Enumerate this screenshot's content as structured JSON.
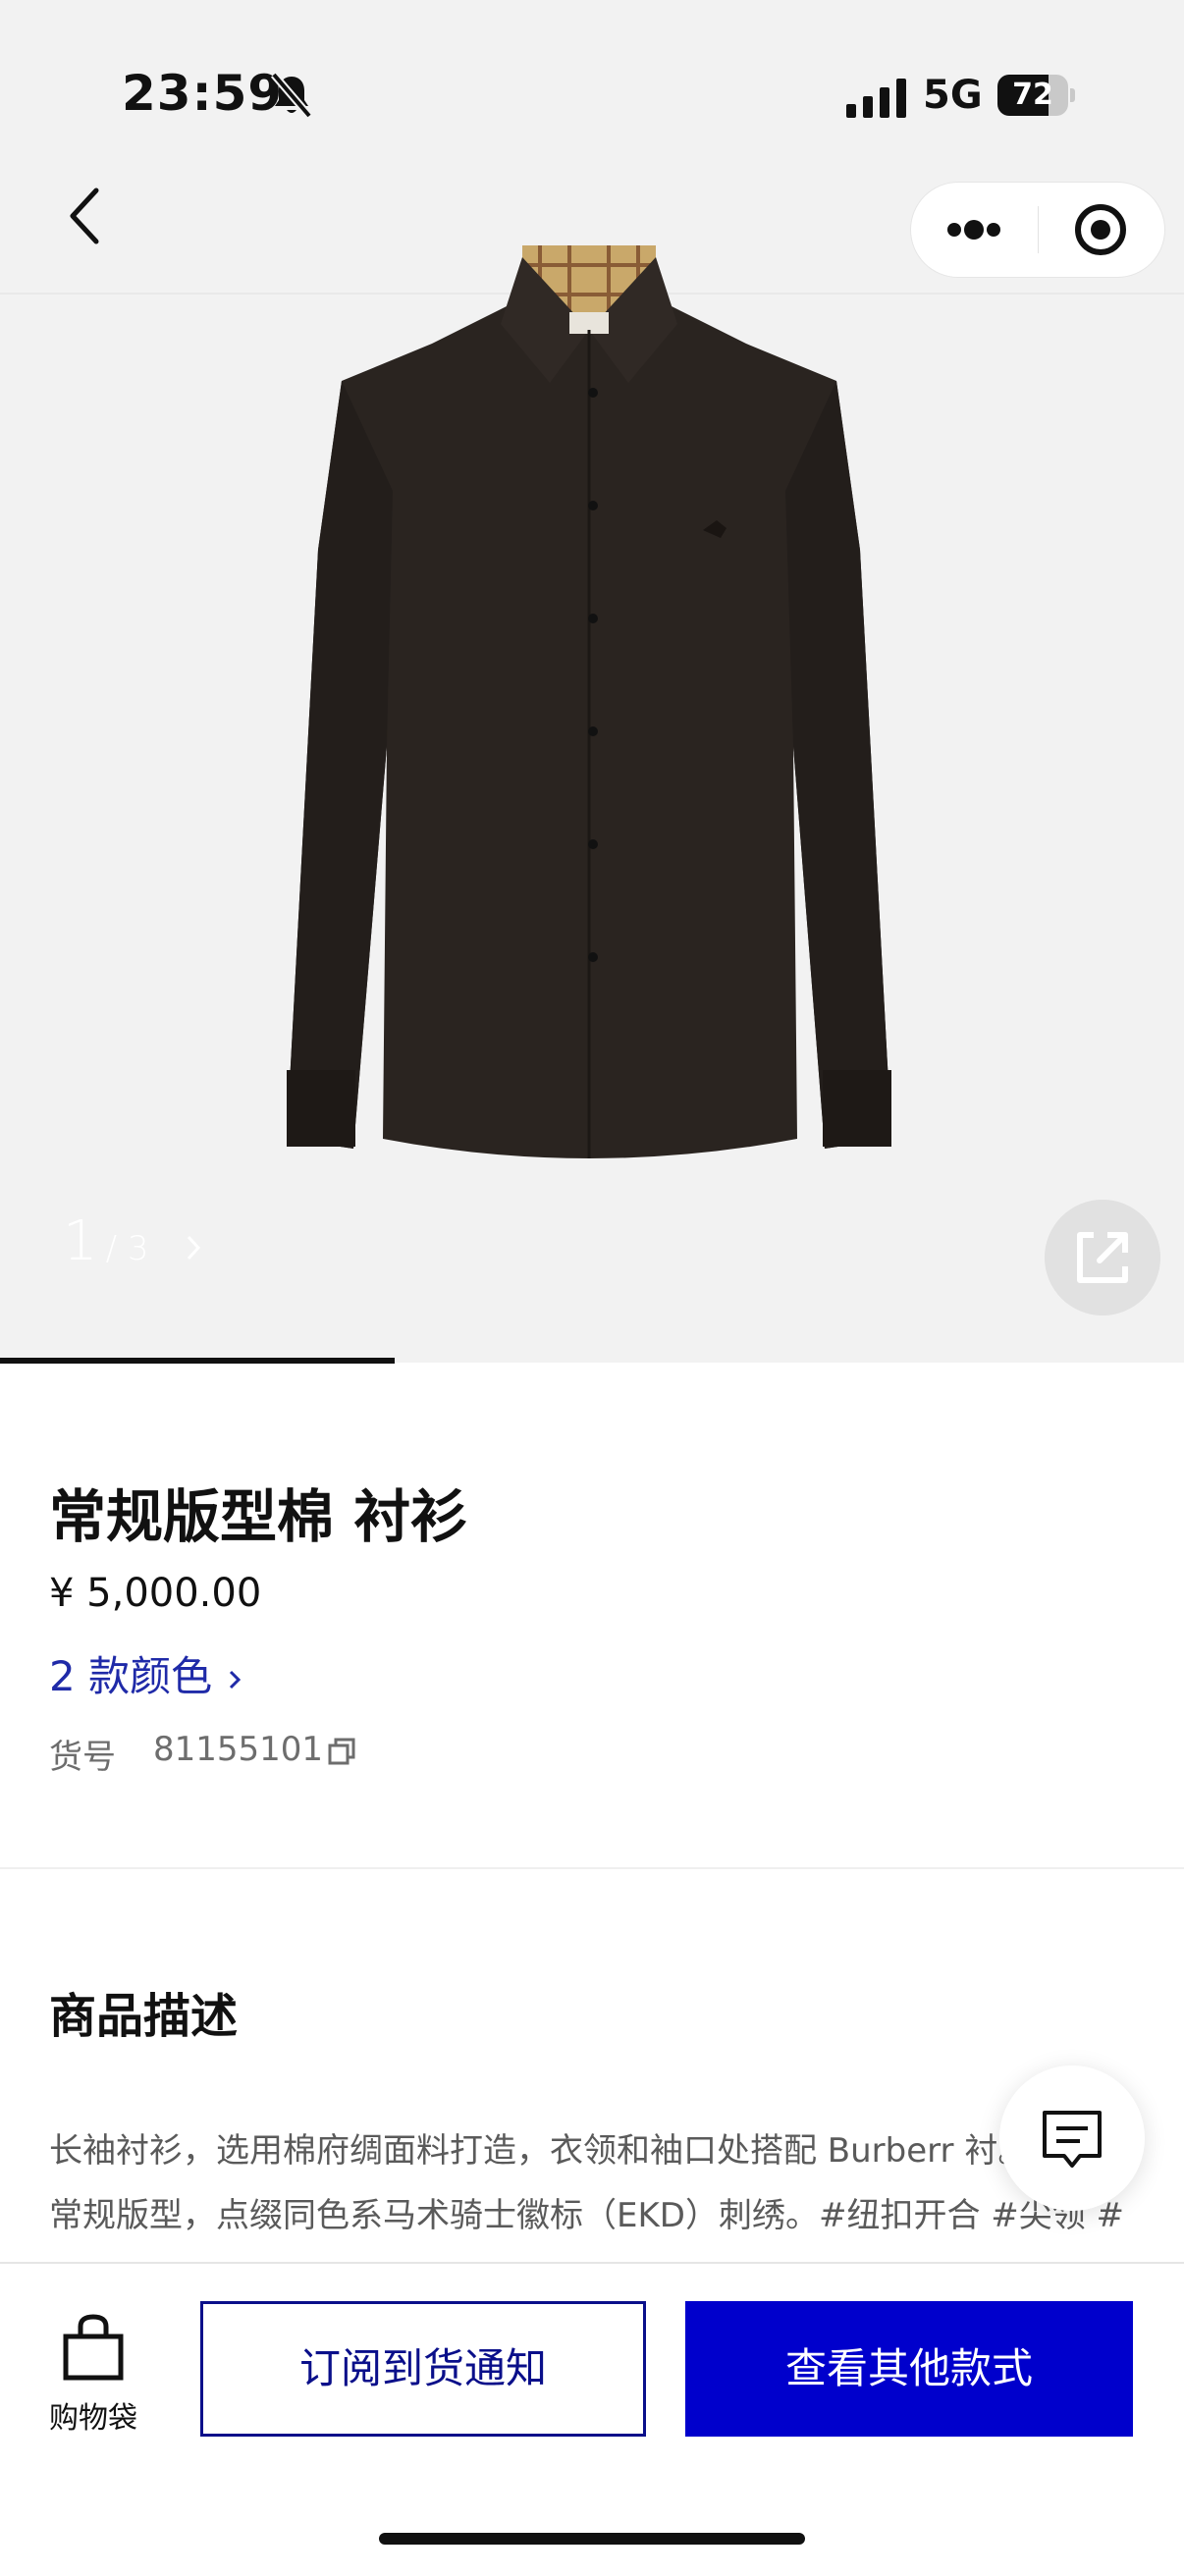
{
  "status_bar": {
    "time": "23:59",
    "network": "5G",
    "battery": "72",
    "battery_level": 0.72
  },
  "gallery": {
    "current": "1",
    "total": "/ 3",
    "progress": 0.3333
  },
  "product": {
    "title": "常规版型棉      衬衫",
    "price": "¥ 5,000.00",
    "colors_link": "2 款颜色",
    "sku_label": "货号",
    "sku_value": "81155101"
  },
  "description": {
    "heading": "商品描述",
    "text": "长袖衬衫，选用棉府绸面料打造，衣领和袖口处搭配 Burberr 衬。呈现常规版型，点缀同色系马术骑士徽标（EKD）刺绣。#纽扣开合 #尖领 #单扣式袖口 #弧形衣摆 #前胸饰有马术骑士徽标（EKD）刺"
  },
  "bottom_bar": {
    "bag_label": "购物袋",
    "notify_label": "订阅到货通知",
    "other_styles_label": "查看其他款式"
  },
  "colors": {
    "accent_blue": "#0000cc",
    "link_blue": "#1f2aa8",
    "outline_navy": "#0a0f8a"
  },
  "icons": [
    "mute-icon",
    "signal-icon",
    "back-arrow-icon",
    "more-dots-icon",
    "target-icon",
    "share-icon",
    "copy-icon",
    "chat-icon",
    "shopping-bag-icon"
  ]
}
